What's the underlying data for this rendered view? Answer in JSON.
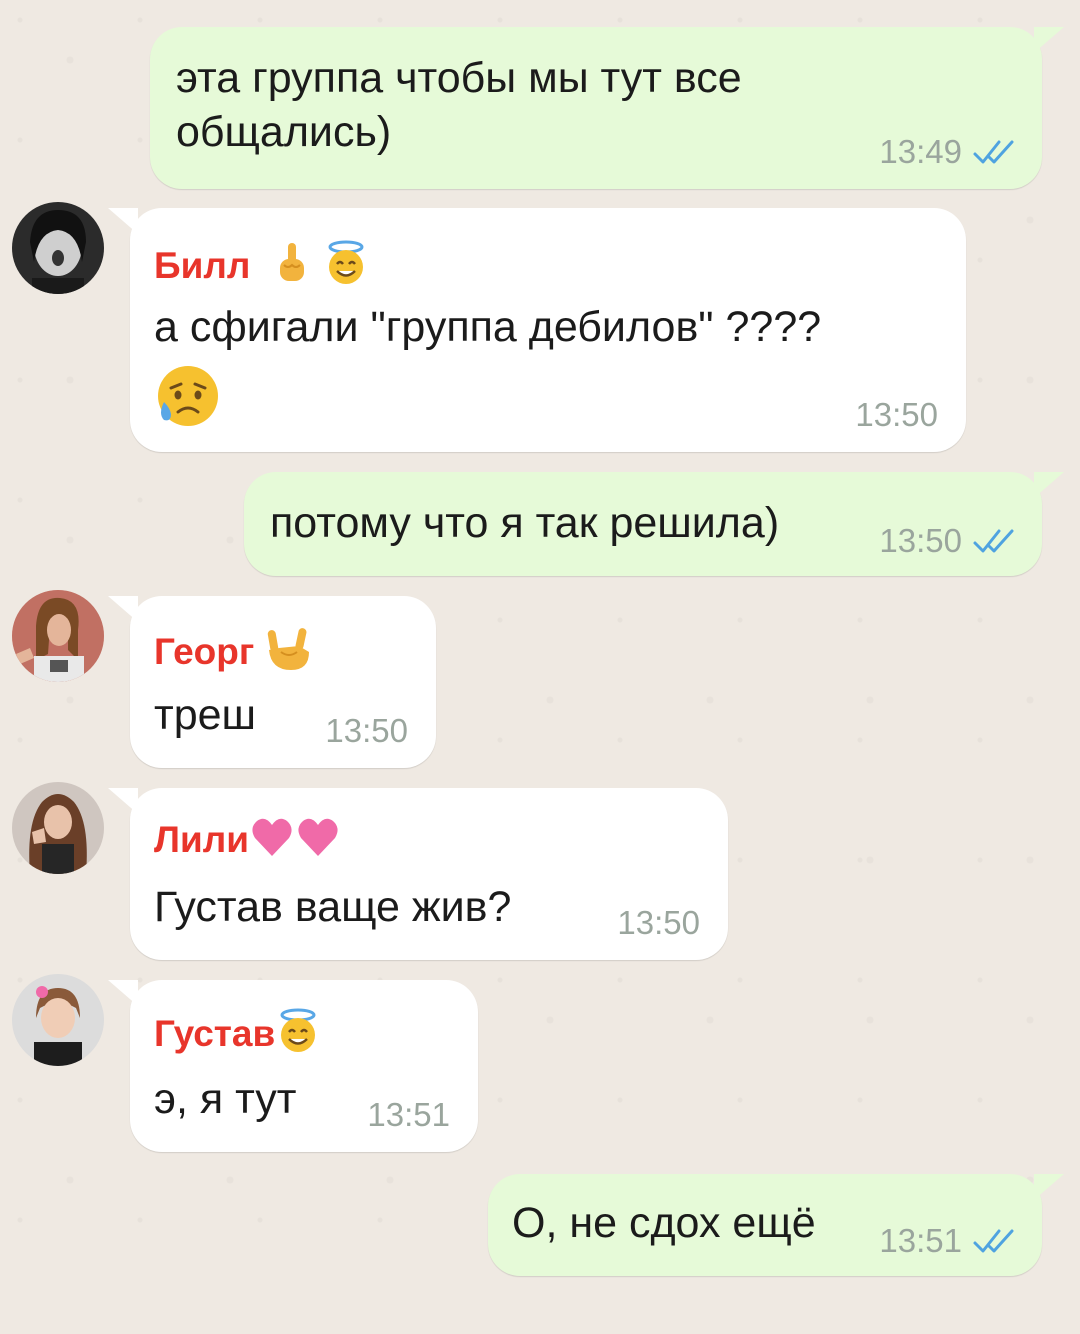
{
  "chat": {
    "messages": [
      {
        "direction": "outgoing",
        "text_line1": "эта группа чтобы мы тут все",
        "text_line2": "общались)",
        "time": "13:49",
        "status": "read-double-check-icon"
      },
      {
        "direction": "incoming",
        "sender": "Билл",
        "sender_emojis": [
          "middle-finger-emoji",
          "smiling-face-with-halo-emoji"
        ],
        "text": "а сфигали \"группа дебилов\" ????",
        "text_emoji": "sad-but-relieved-face-emoji",
        "time": "13:50",
        "avatar": "bill-avatar"
      },
      {
        "direction": "outgoing",
        "text": "потому что я так решила)",
        "time": "13:50",
        "status": "read-double-check-icon"
      },
      {
        "direction": "incoming",
        "sender": "Георг",
        "sender_emojis": [
          "sign-of-horns-emoji"
        ],
        "text": "треш",
        "time": "13:50",
        "avatar": "georg-avatar"
      },
      {
        "direction": "incoming",
        "sender": "Лили",
        "sender_emojis": [
          "heart-emoji",
          "heart-emoji"
        ],
        "text": "Густав ваще жив?",
        "time": "13:50",
        "avatar": "lili-avatar"
      },
      {
        "direction": "incoming",
        "sender": "Густав",
        "sender_emojis": [
          "smiling-face-with-halo-emoji"
        ],
        "text": "э, я тут",
        "time": "13:51",
        "avatar": "gustav-avatar"
      },
      {
        "direction": "outgoing",
        "text": "О, не сдох ещё",
        "time": "13:51",
        "status": "read-double-check-icon"
      }
    ]
  },
  "colors": {
    "background": "#efe9e2",
    "outgoing_bubble": "#e6fad8",
    "incoming_bubble": "#ffffff",
    "sender_name": "#e8352b",
    "timestamp": "#9aa59d",
    "read_ticks": "#4fa3e0"
  }
}
